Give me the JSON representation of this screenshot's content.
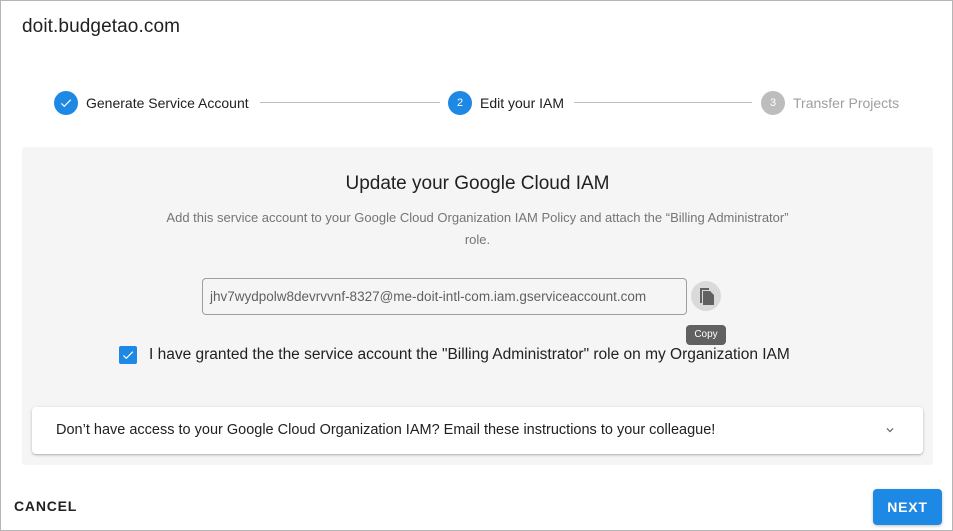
{
  "dialog": {
    "title": "doit.budgetao.com"
  },
  "stepper": {
    "steps": [
      {
        "number": "",
        "label": "Generate Service Account",
        "state": "completed"
      },
      {
        "number": "2",
        "label": "Edit your IAM",
        "state": "active"
      },
      {
        "number": "3",
        "label": "Transfer Projects",
        "state": "inactive"
      }
    ]
  },
  "content": {
    "heading": "Update your Google Cloud IAM",
    "description": "Add this service account to your Google Cloud Organization IAM Policy and attach the “Billing Administrator” role.",
    "service_account": "jhv7wydpolw8devrvvnf-8327@me-doit-intl-com.iam.gserviceaccount.com",
    "copy_tooltip": "Copy",
    "copy_icon": "copy-icon",
    "checkbox_checked": true,
    "checkbox_label": "I have granted the the service account the \"Billing Administrator\" role on my Organization IAM",
    "expander_text": "Don’t have access to your Google Cloud Organization IAM? Email these instructions to your colleague!",
    "expander_icon": "chevron-down-icon"
  },
  "footer": {
    "cancel_label": "CANCEL",
    "next_label": "NEXT"
  },
  "colors": {
    "accent": "#1e88e5",
    "inactive_step": "#bdbdbd",
    "card_bg": "#f5f5f5"
  }
}
